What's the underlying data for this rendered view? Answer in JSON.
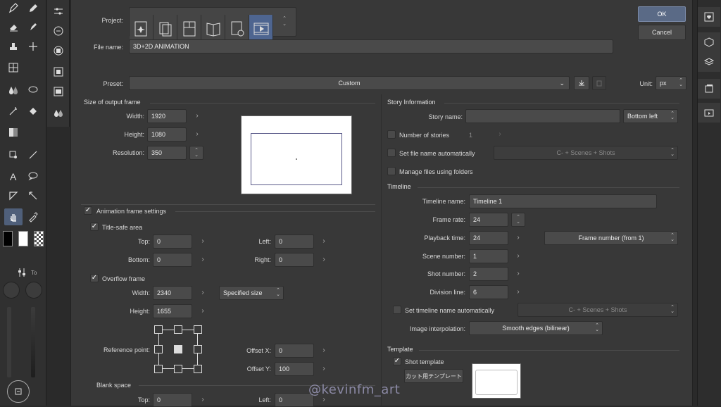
{
  "window": {
    "ok_label": "OK",
    "cancel_label": "Cancel"
  },
  "left_panel": {
    "tab_label": "To"
  },
  "project": {
    "label": "Project:",
    "icons": [
      "illustration-project-icon",
      "comic-project-icon",
      "single-page-project-icon",
      "book-project-icon",
      "print-settings-project-icon",
      "animation-project-icon"
    ]
  },
  "file_name": {
    "label": "File name:",
    "value": "3D+2D ANIMATION"
  },
  "preset": {
    "label": "Preset:",
    "value": "Custom"
  },
  "unit": {
    "label": "Unit:",
    "value": "px"
  },
  "output_frame": {
    "title": "Size of output frame",
    "width_label": "Width:",
    "width": "1920",
    "height_label": "Height:",
    "height": "1080",
    "resolution_label": "Resolution:",
    "resolution": "350"
  },
  "animation_frame": {
    "label": "Animation frame settings",
    "title_safe_label": "Title-safe area",
    "top_label": "Top:",
    "top": "0",
    "left_label": "Left:",
    "left": "0",
    "bottom_label": "Bottom:",
    "bottom": "0",
    "right_label": "Right:",
    "right": "0",
    "overflow_label": "Overflow frame",
    "of_width_label": "Width:",
    "of_width": "2340",
    "of_height_label": "Height:",
    "of_height": "1655",
    "size_mode": "Specified size",
    "reference_point_label": "Reference point:",
    "offset_x_label": "Offset X:",
    "offset_x": "0",
    "offset_y_label": "Offset Y:",
    "offset_y": "100",
    "blank_space_label": "Blank space",
    "blank_top_label": "Top:",
    "blank_top": "0",
    "blank_left_label": "Left:",
    "blank_left": "0"
  },
  "story": {
    "title": "Story Information",
    "story_name_label": "Story name:",
    "story_name": "",
    "story_pos": "Bottom left",
    "num_stories_label": "Number of stories",
    "num_stories": "1",
    "set_file_name_label": "Set file name automatically",
    "file_name_pattern": "C- + Scenes + Shots",
    "manage_files_label": "Manage files using folders"
  },
  "timeline": {
    "title": "Timeline",
    "name_label": "Timeline name:",
    "name": "Timeline 1",
    "frame_rate_label": "Frame rate:",
    "frame_rate": "24",
    "playback_label": "Playback time:",
    "playback": "24",
    "frame_number_mode": "Frame number (from 1)",
    "scene_label": "Scene number:",
    "scene": "1",
    "shot_label": "Shot number:",
    "shot": "2",
    "division_label": "Division line:",
    "division": "6",
    "set_timeline_name_label": "Set timeline name automatically",
    "timeline_name_pattern": "C- + Scenes + Shots",
    "interp_label": "Image interpolation:",
    "interp": "Smooth edges (bilinear)"
  },
  "template": {
    "title": "Template",
    "shot_template_label": "Shot template",
    "template_button": "カット用テンプレート"
  },
  "watermark": "@kevinfm_art"
}
